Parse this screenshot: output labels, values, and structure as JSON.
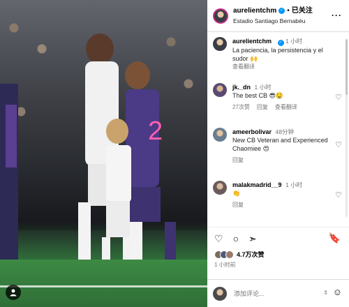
{
  "post": {
    "username": "aurelientchm",
    "follow_label": "已关注",
    "location": "Estadio Santiago Bernabéu",
    "caption": "La paciencia, la persistencia y el sudor",
    "caption_time": "1 小时",
    "see_translation": "查看翻译"
  },
  "comments": [
    {
      "username": "jk._dn",
      "time": "1 小时",
      "text": "The best CB",
      "likes": "27次赞",
      "reply": "回复",
      "translate": "查看翻译"
    },
    {
      "username": "ameerbolivar",
      "time": "48分钟",
      "text": "New CB Veteran and Experienced Chaomiee",
      "reply": "回复"
    },
    {
      "username": "malakmadrid__9",
      "time": "1 小时",
      "text": "",
      "reply": "回复"
    }
  ],
  "actions": {
    "like_count": "4.7万次赞",
    "posted_ago": "1 小时前"
  },
  "composer": {
    "placeholder": "添加评论..."
  },
  "icons": {
    "more": "more-icon",
    "heart": "heart-icon",
    "comment": "comment-icon",
    "share": "share-icon",
    "bookmark": "bookmark-icon",
    "emoji": "emoji-icon"
  },
  "colors": {
    "verified": "#0095f6",
    "story_ring": "#c72e8c"
  }
}
